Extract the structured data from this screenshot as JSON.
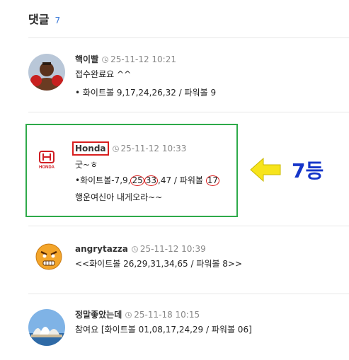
{
  "header": {
    "title": "댓글",
    "count": "7"
  },
  "comments": [
    {
      "author": "핵이빨",
      "date": "25-11-12 10:21",
      "line1": "접수완료요 ^^",
      "line2": "• 화이트볼 9,17,24,26,32 / 파워볼 9",
      "avatar": "boxer-photo"
    },
    {
      "author": "Honda",
      "date": "25-11-12 10:33",
      "line1": "굿~ㅎ",
      "line2": {
        "prefix": "•화이트볼-7,9,",
        "n1": "25",
        "n2": "33",
        "suffix": ",47 / 파워볼 ",
        "n3": "17"
      },
      "line3": "행운여신아 내게오라~~",
      "avatar": "honda-logo",
      "logo_text": "HONDA"
    },
    {
      "author": "angrytazza",
      "date": "25-11-12 10:39",
      "line1": "<<화이트볼 26,29,31,34,65 / 파워볼 8>>",
      "avatar": "angry-face-emoji"
    },
    {
      "author": "정말좋았는데",
      "date": "25-11-18 10:15",
      "line1": "참여요 [화이트볼 01,08,17,24,29 / 파워볼 06]",
      "avatar": "sydney-opera-house-photo"
    }
  ],
  "annotation": {
    "rank_label": "7등",
    "arrow_color": "#f7e41c",
    "box_color": "#2eaa4a",
    "highlight_color": "#d81e1e"
  }
}
